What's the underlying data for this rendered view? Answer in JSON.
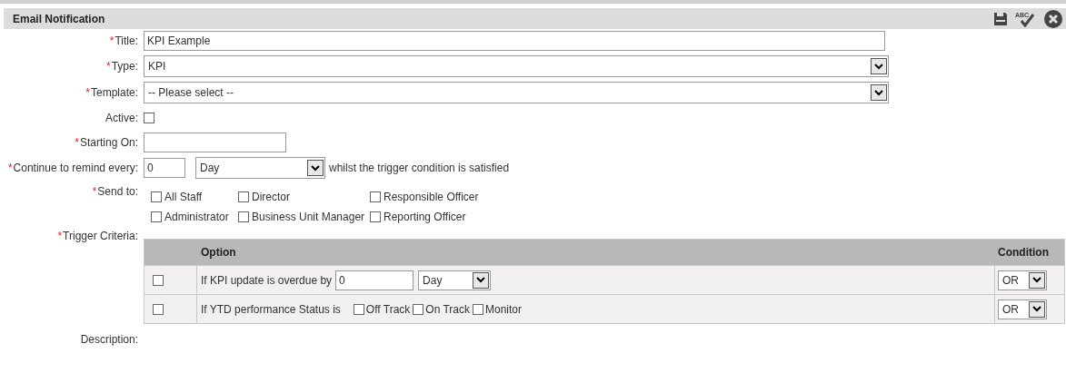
{
  "panel": {
    "title": "Email Notification",
    "tools": [
      {
        "kind": "save"
      },
      {
        "kind": "spellcheck",
        "label": "ABC"
      },
      {
        "kind": "close"
      }
    ]
  },
  "fields": [
    {
      "kind": "text",
      "mark": "*",
      "label": "Title:",
      "value": "KPI Example"
    },
    {
      "kind": "select",
      "mark": "*",
      "label": "Type:",
      "value": "KPI"
    },
    {
      "kind": "select",
      "mark": "*",
      "label": "Template:",
      "value": "-- Please select --"
    },
    {
      "kind": "checkbox",
      "label": "Active:",
      "checked": false
    },
    {
      "kind": "date",
      "mark": "*",
      "label": "Starting On:"
    },
    {
      "kind": "remind",
      "mark": "*",
      "label": "Continue to remind every:",
      "value": "0",
      "unit": "Day",
      "suffix": "whilst the trigger condition is satisfied"
    },
    {
      "kind": "recipients",
      "mark": "*",
      "label": "Send to:",
      "options": [
        {
          "label": "All Staff",
          "checked": false
        },
        {
          "label": "Director",
          "checked": false
        },
        {
          "label": "Responsible Officer",
          "checked": false
        },
        {
          "label": "Administrator",
          "checked": false
        },
        {
          "label": "Business Unit Manager",
          "checked": false
        },
        {
          "label": "Reporting Officer",
          "checked": false
        }
      ]
    },
    {
      "kind": "criteria",
      "mark": "*",
      "label": "Trigger Criteria:"
    },
    {
      "kind": "plain",
      "label": "Description:"
    }
  ],
  "criteria": {
    "columns": [
      "Option",
      "Condition"
    ],
    "rows": [
      {
        "kind": "overdue",
        "checked": false,
        "text": "If KPI update is overdue by",
        "value": "0",
        "unit": "Day",
        "condition": "OR"
      },
      {
        "kind": "status",
        "checked": false,
        "text": "If YTD performance Status is",
        "statuses": [
          {
            "label": "Off Track",
            "checked": false
          },
          {
            "label": "On Track",
            "checked": false
          },
          {
            "label": "Monitor",
            "checked": false
          }
        ],
        "condition": "OR"
      }
    ]
  }
}
